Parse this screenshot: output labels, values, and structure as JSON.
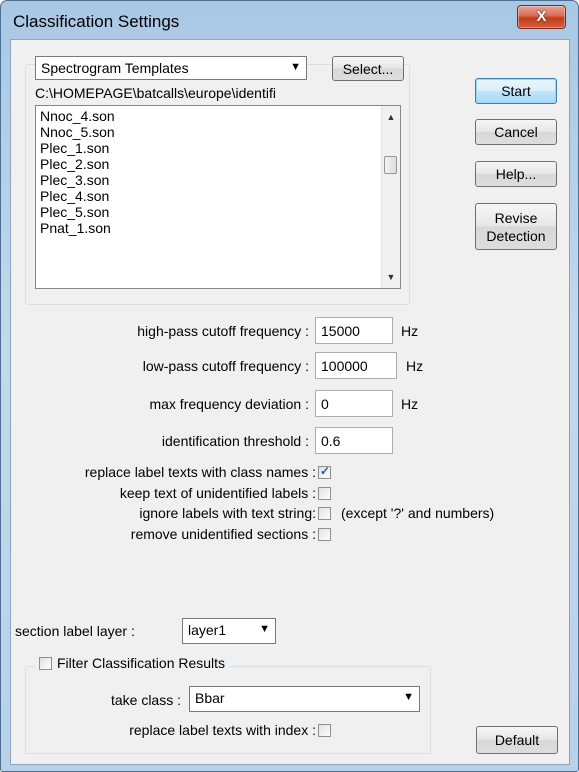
{
  "window": {
    "title": "Classification Settings",
    "close_glyph": "X"
  },
  "templates": {
    "combo_value": "Spectrogram Templates",
    "select_label": "Select...",
    "path": "C:\\HOMEPAGE\\batcalls\\europe\\identifi",
    "files": [
      "Nnoc_4.son",
      "Nnoc_5.son",
      "Plec_1.son",
      "Plec_2.son",
      "Plec_3.son",
      "Plec_4.son",
      "Plec_5.son",
      "Pnat_1.son"
    ]
  },
  "buttons": {
    "start": "Start",
    "cancel": "Cancel",
    "help": "Help...",
    "revise_line1": "Revise",
    "revise_line2": "Detection",
    "default": "Default"
  },
  "fields": {
    "highpass_label": "high-pass cutoff frequency :",
    "highpass_value": "15000",
    "highpass_unit": "Hz",
    "lowpass_label": "low-pass cutoff frequency :",
    "lowpass_value": "100000",
    "lowpass_unit": "Hz",
    "maxdev_label": "max frequency deviation :",
    "maxdev_value": "0",
    "maxdev_unit": "Hz",
    "threshold_label": "identification threshold :",
    "threshold_value": "0.6"
  },
  "options": {
    "replace_label": "replace label texts with class names :",
    "replace_checked": true,
    "keep_label": "keep text of unidentified labels :",
    "keep_checked": false,
    "ignore_label": "ignore labels with text string:",
    "ignore_checked": false,
    "ignore_note": "(except '?' and numbers)",
    "remove_label": "remove unidentified sections :",
    "remove_checked": false
  },
  "layer": {
    "label": "section label layer :",
    "value": "layer1"
  },
  "filter": {
    "label": "Filter Classification Results",
    "checked": false,
    "take_class_label": "take class :",
    "take_class_value": "Bbar",
    "replace_index_label": "replace label texts with index :",
    "replace_index_checked": false
  }
}
